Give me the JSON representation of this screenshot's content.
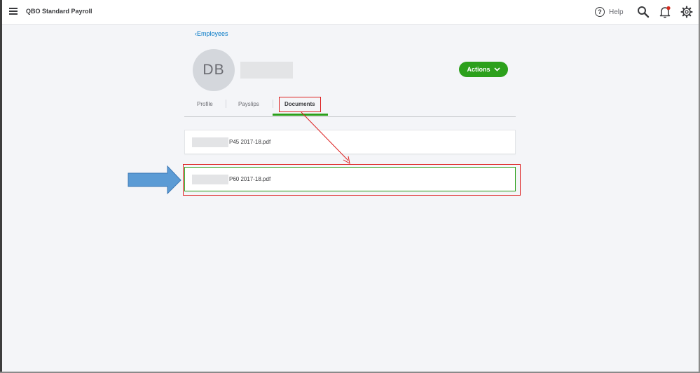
{
  "app": {
    "title": "QBO Standard Payroll",
    "help_label": "Help",
    "help_glyph": "?"
  },
  "employee": {
    "back_link": "Employees",
    "back_chevron": "‹",
    "initials": "DB"
  },
  "actions": {
    "label": "Actions"
  },
  "tabs": [
    {
      "label": "Profile"
    },
    {
      "label": "Payslips"
    },
    {
      "label": "Documents",
      "active": true
    }
  ],
  "documents": [
    {
      "name": "P45 2017-18.pdf"
    },
    {
      "name": "P60 2017-18.pdf"
    }
  ],
  "colors": {
    "accent_green": "#2ca01c",
    "link_blue": "#0077c5",
    "annotation_red": "#dd2222",
    "arrow_blue": "#5b9bd5"
  },
  "icons": {
    "menu": "hamburger-menu-icon",
    "help": "help-circle-icon",
    "search": "search-icon",
    "notifications": "bell-icon",
    "settings": "gear-icon"
  }
}
